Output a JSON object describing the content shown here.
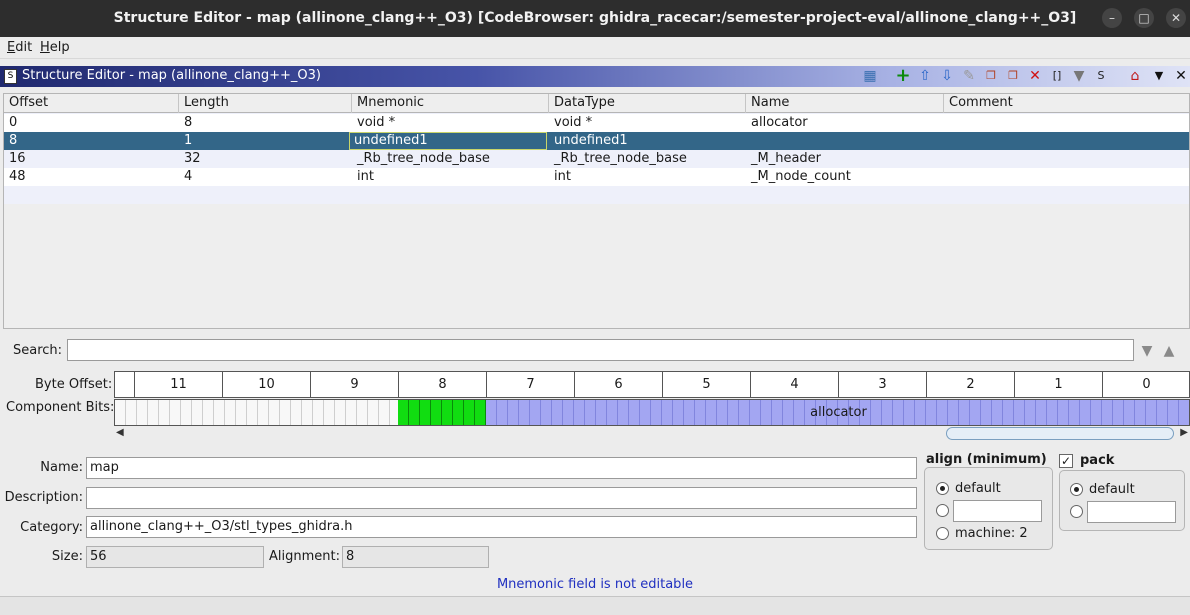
{
  "window": {
    "title": "Structure Editor - map (allinone_clang++_O3) [CodeBrowser: ghidra_racecar:/semester-project-eval/allinone_clang++_O3]",
    "minimize": "–",
    "maximize": "□",
    "close": "✕"
  },
  "menu": {
    "edit_first": "E",
    "edit_rest": "dit",
    "help_first": "H",
    "help_rest": "elp"
  },
  "panel": {
    "title": "Structure Editor - map (allinone_clang++_O3)",
    "icon_glyph": "S"
  },
  "table": {
    "columns": [
      "Offset",
      "Length",
      "Mnemonic",
      "DataType",
      "Name",
      "Comment"
    ],
    "rows": [
      {
        "offset": "0",
        "length": "8",
        "mnemonic": "void *",
        "datatype": "void *",
        "name": "allocator",
        "comment": ""
      },
      {
        "offset": "8",
        "length": "1",
        "mnemonic": "undefined1",
        "datatype": "undefined1",
        "name": "",
        "comment": ""
      },
      {
        "offset": "16",
        "length": "32",
        "mnemonic": "_Rb_tree_node_base",
        "datatype": "_Rb_tree_node_base",
        "name": "_M_header",
        "comment": ""
      },
      {
        "offset": "48",
        "length": "4",
        "mnemonic": "int",
        "datatype": "int",
        "name": "_M_node_count",
        "comment": ""
      }
    ],
    "selected_row": 1
  },
  "search": {
    "label": "Search:",
    "value": ""
  },
  "bitview": {
    "byte_offset_label": "Byte Offset:",
    "component_bits_label": "Component Bits:",
    "byte_offsets": [
      "11",
      "10",
      "9",
      "8",
      "7",
      "6",
      "5",
      "4",
      "3",
      "2",
      "1",
      "0"
    ],
    "segments": [
      {
        "kind": "empty",
        "label": ""
      },
      {
        "kind": "green",
        "label": ""
      },
      {
        "kind": "blue",
        "label": "allocator"
      }
    ],
    "colors": {
      "undefined": "#11dd11",
      "component": "#a3a6f2"
    }
  },
  "form": {
    "name_label": "Name:",
    "name_value": "map",
    "description_label": "Description:",
    "description_value": "",
    "category_label": "Category:",
    "category_value": "allinone_clang++_O3/stl_types_ghidra.h",
    "size_label": "Size:",
    "size_value": "56",
    "alignment_label": "Alignment:",
    "alignment_value": "8"
  },
  "align": {
    "title": "align (minimum)",
    "default_label": "default",
    "custom_value": "",
    "machine_label": "machine: 2"
  },
  "pack": {
    "title": "pack",
    "checked": true,
    "default_label": "default",
    "custom_value": ""
  },
  "status": "Mnemonic field is not editable"
}
